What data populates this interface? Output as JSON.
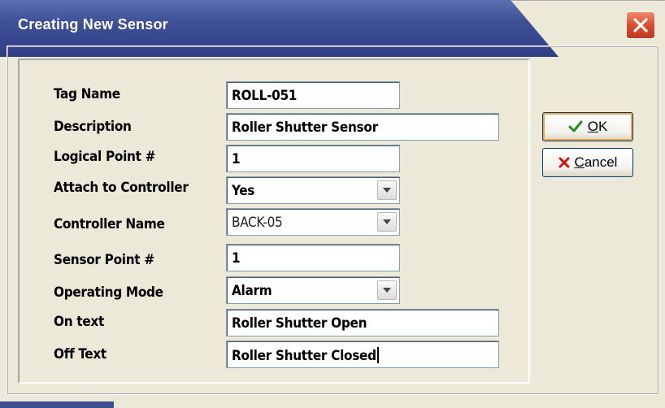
{
  "window": {
    "title": "Creating New Sensor"
  },
  "form": {
    "tag_name": {
      "label": "Tag Name",
      "value": "ROLL-051"
    },
    "description": {
      "label": "Description",
      "value": "Roller Shutter Sensor"
    },
    "logical_point": {
      "label": "Logical Point #",
      "value": "1"
    },
    "attach_to_controller": {
      "label": "Attach to Controller",
      "value": "Yes"
    },
    "controller_name": {
      "label": "Controller Name",
      "value": "BACK-05"
    },
    "sensor_point": {
      "label": "Sensor Point #",
      "value": "1"
    },
    "operating_mode": {
      "label": "Operating Mode",
      "value": "Alarm"
    },
    "on_text": {
      "label": "On text",
      "value": "Roller Shutter Open"
    },
    "off_text": {
      "label": "Off Text",
      "value": "Roller Shutter Closed"
    }
  },
  "buttons": {
    "ok": {
      "mnemonic": "O",
      "rest": "K",
      "icon": "check-icon"
    },
    "cancel": {
      "mnemonic": "C",
      "rest": "ancel",
      "icon": "x-icon"
    }
  },
  "colors": {
    "title_bar": "#2f3e87",
    "close_button": "#d9482a",
    "ok_check": "#2a8a2a",
    "cancel_x": "#cc1111"
  }
}
